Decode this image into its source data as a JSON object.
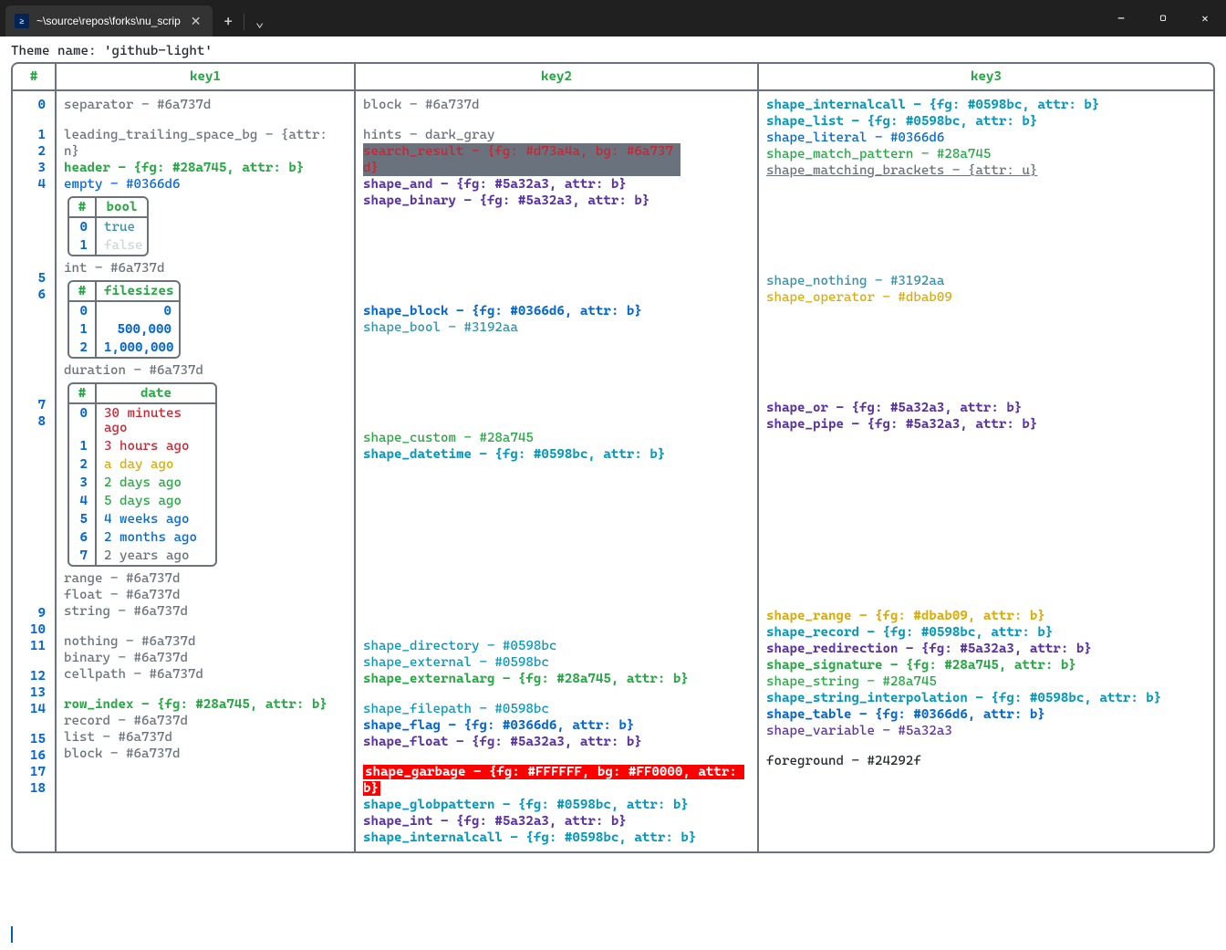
{
  "window": {
    "tab_title": "~\\source\\repos\\forks\\nu_scrip",
    "new_tab": "+",
    "menu": "⌄",
    "min": "—",
    "max": "▢",
    "close": "✕"
  },
  "theme_line": "Theme name: 'github-light'",
  "headers": {
    "idx": "#",
    "k1": "key1",
    "k2": "key2",
    "k3": "key3"
  },
  "idx": [
    "0",
    "1",
    "2",
    "3",
    "4",
    "",
    "5",
    "6",
    "",
    "7",
    "8",
    "",
    "9",
    "10",
    "11",
    "12",
    "13",
    "14",
    "15",
    "16",
    "17",
    "18"
  ],
  "k1": {
    "separator": "separator - #6a737d",
    "leading": "leading_trailing_space_bg - {attr: n}",
    "header": "header - {fg: #28a745, attr: b}",
    "empty": "empty - #0366d6",
    "int": "int - #6a737d",
    "duration": "duration - #6a737d",
    "range": "range - #6a737d",
    "float": "float - #6a737d",
    "string": "string - #6a737d",
    "nothing": "nothing - #6a737d",
    "binary": "binary - #6a737d",
    "cellpath": "cellpath - #6a737d",
    "row_index": "row_index - {fg: #28a745, attr: b}",
    "record": "record - #6a737d",
    "list": "list - #6a737d",
    "block_k1": "block - #6a737d",
    "bool_head_idx": "#",
    "bool_head": "bool",
    "bool_rows": [
      {
        "i": "0",
        "v": "true",
        "c": "c-teal"
      },
      {
        "i": "1",
        "v": "false",
        "c": "c-faint"
      }
    ],
    "fs_head_idx": "#",
    "fs_head": "filesizes",
    "fs_rows": [
      {
        "i": "0",
        "v": "0"
      },
      {
        "i": "1",
        "v": "500,000"
      },
      {
        "i": "2",
        "v": "1,000,000"
      }
    ],
    "date_head_idx": "#",
    "date_head": "date",
    "date_rows": [
      {
        "i": "0",
        "v": "30 minutes ago",
        "c": "c-red"
      },
      {
        "i": "1",
        "v": "3 hours ago",
        "c": "c-red"
      },
      {
        "i": "2",
        "v": "a day ago",
        "c": "c-yellow"
      },
      {
        "i": "3",
        "v": "2 days ago",
        "c": "c-green"
      },
      {
        "i": "4",
        "v": "5 days ago",
        "c": "c-green"
      },
      {
        "i": "5",
        "v": "4 weeks ago",
        "c": "c-blue"
      },
      {
        "i": "6",
        "v": "2 months ago",
        "c": "c-blue"
      },
      {
        "i": "7",
        "v": "2 years ago",
        "c": "c-sep"
      }
    ]
  },
  "k2": {
    "block": "block - #6a737d",
    "hints": "hints - dark_gray",
    "search_result": "search_result - {fg: #d73a4a, bg: #6a737d}",
    "shape_and": "shape_and - {fg: #5a32a3, attr: b}",
    "shape_binary": "shape_binary - {fg: #5a32a3, attr: b}",
    "shape_block": "shape_block - {fg: #0366d6, attr: b}",
    "shape_bool": "shape_bool - #3192aa",
    "shape_custom": "shape_custom - #28a745",
    "shape_datetime": "shape_datetime - {fg: #0598bc, attr: b}",
    "shape_directory": "shape_directory - #0598bc",
    "shape_external": "shape_external - #0598bc",
    "shape_externalarg": "shape_externalarg - {fg: #28a745, attr: b}",
    "shape_filepath": "shape_filepath - #0598bc",
    "shape_flag": "shape_flag - {fg: #0366d6, attr: b}",
    "shape_float": "shape_float - {fg: #5a32a3, attr: b}",
    "shape_garbage": "shape_garbage - {fg: #FFFFFF, bg: #FF0000, attr: b}",
    "shape_globpattern": "shape_globpattern - {fg: #0598bc, attr: b}",
    "shape_int": "shape_int - {fg: #5a32a3, attr: b}",
    "shape_internalcall": "shape_internalcall - {fg: #0598bc, attr: b}"
  },
  "k3": {
    "shape_internalcall": "shape_internalcall - {fg: #0598bc, attr: b}",
    "shape_list": "shape_list - {fg: #0598bc, attr: b}",
    "shape_literal": "shape_literal - #0366d6",
    "shape_match_pattern": "shape_match_pattern - #28a745",
    "shape_matching_brackets": "shape_matching_brackets - {attr: u}",
    "shape_nothing": "shape_nothing - #3192aa",
    "shape_operator": "shape_operator - #dbab09",
    "shape_or": "shape_or - {fg: #5a32a3, attr: b}",
    "shape_pipe": "shape_pipe - {fg: #5a32a3, attr: b}",
    "shape_range": "shape_range - {fg: #dbab09, attr: b}",
    "shape_record": "shape_record - {fg: #0598bc, attr: b}",
    "shape_redirection": "shape_redirection - {fg: #5a32a3, attr: b}",
    "shape_signature": "shape_signature - {fg: #28a745, attr: b}",
    "shape_string": "shape_string - #28a745",
    "shape_string_interpolation": "shape_string_interpolation - {fg: #0598bc, attr: b}",
    "shape_table": "shape_table - {fg: #0366d6, attr: b}",
    "shape_variable": "shape_variable - #5a32a3",
    "foreground": "foreground - #24292f"
  }
}
